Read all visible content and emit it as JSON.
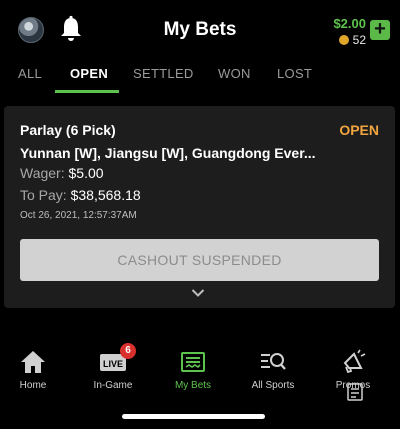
{
  "header": {
    "title": "My Bets",
    "balance": "$2.00",
    "bonus": "52",
    "add_symbol": "+"
  },
  "tabs": [
    {
      "label": "ALL",
      "active": false
    },
    {
      "label": "OPEN",
      "active": true
    },
    {
      "label": "SETTLED",
      "active": false
    },
    {
      "label": "WON",
      "active": false
    },
    {
      "label": "LOST",
      "active": false
    }
  ],
  "bet": {
    "type": "Parlay (6 Pick)",
    "status": "OPEN",
    "teams": "Yunnan [W], Jiangsu [W], Guangdong Ever...",
    "wager_label": "Wager:",
    "wager_value": "$5.00",
    "payout_label": "To Pay:",
    "payout_value": "$38,568.18",
    "date": "Oct 26, 2021, 12:57:37AM",
    "cashout_label": "CASHOUT SUSPENDED"
  },
  "nav": [
    {
      "label": "Home",
      "icon": "home-icon"
    },
    {
      "label": "In-Game",
      "icon": "live-icon",
      "badge": "6"
    },
    {
      "label": "My Bets",
      "icon": "bet-slip-icon",
      "active": true
    },
    {
      "label": "All Sports",
      "icon": "search-list-icon"
    },
    {
      "label": "Promos",
      "icon": "megaphone-icon"
    }
  ],
  "colors": {
    "accent": "#5ec34e",
    "status_open": "#f1a53f",
    "badge": "#d8312d",
    "card": "#1d1d1d"
  }
}
